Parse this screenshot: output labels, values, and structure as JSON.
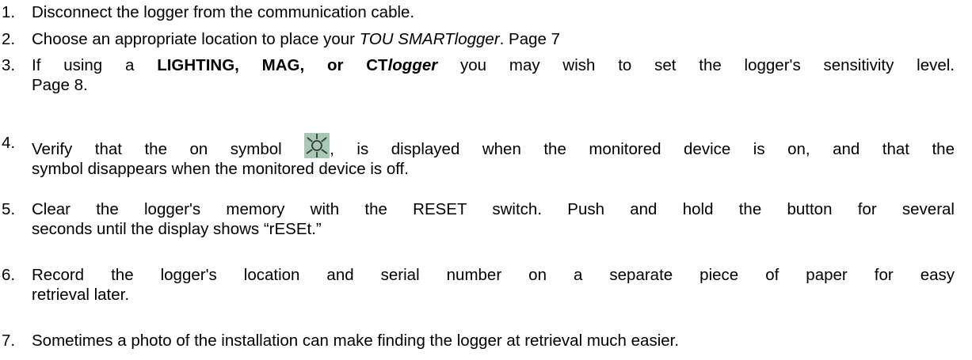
{
  "steps": [
    {
      "number": "1.",
      "text": "Disconnect the logger from the communication cable."
    },
    {
      "number": "2.",
      "text_before": "Choose an appropriate location to place your ",
      "italic": "TOU SMARTlogger",
      "text_after": ". Page 7"
    },
    {
      "number": "3.",
      "line1_before": "If using a ",
      "bold": "LIGHTING, MAG, or CT",
      "bold_italic": "logger",
      "line1_after": " you may wish to set the logger's sensitivity level.",
      "line2": "Page 8."
    },
    {
      "number": "4.",
      "line1_before": "Verify that the on symbol ",
      "icon": "on-symbol-icon",
      "line1_after": ", is displayed when the monitored device is on, and that the",
      "line2": "symbol disappears  when the monitored device is off."
    },
    {
      "number": "5.",
      "line1": "Clear the logger's memory with the RESET switch. Push and hold the button for several",
      "line2": "seconds until the display shows “rESEt.”"
    },
    {
      "number": "6.",
      "line1": "Record the logger's location and serial number on a separate piece of paper for easy",
      "line2": "retrieval later."
    },
    {
      "number": "7.",
      "text": "Sometimes a photo of the installation can make finding the logger at retrieval much easier."
    }
  ],
  "colors": {
    "icon_background": "#a9c7b5",
    "icon_stroke": "#2f3a36"
  }
}
